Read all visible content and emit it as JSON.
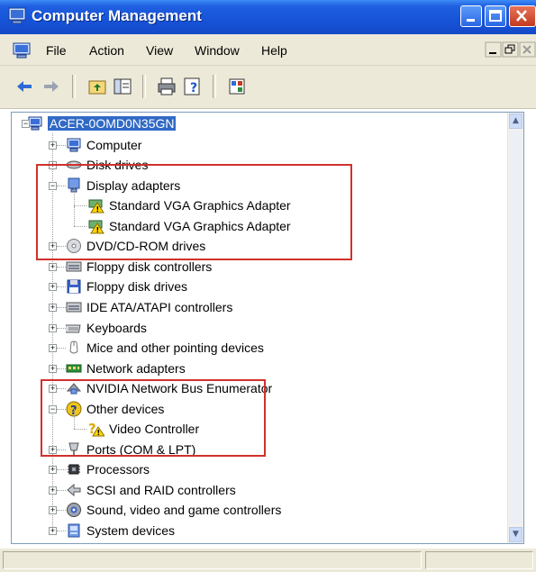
{
  "window": {
    "title": "Computer Management",
    "title_bar_color": "#1653d8"
  },
  "titlebar_buttons": [
    {
      "name": "minimize-icon"
    },
    {
      "name": "maximize-icon"
    },
    {
      "name": "close-icon"
    }
  ],
  "menu": {
    "items": [
      {
        "label": "File"
      },
      {
        "label": "Action"
      },
      {
        "label": "View"
      },
      {
        "label": "Window"
      },
      {
        "label": "Help"
      }
    ]
  },
  "toolbar": {
    "icons": [
      "back-arrow-icon",
      "forward-arrow-icon",
      "up-folder-icon",
      "show-hide-tree-icon",
      "print-icon",
      "help-icon",
      "properties-icon"
    ]
  },
  "tree": {
    "root": {
      "label": "ACER-0OMD0N35GN"
    },
    "items": [
      {
        "label": "Computer",
        "icon": "computer-icon",
        "expanded": false
      },
      {
        "label": "Disk drives",
        "icon": "disk-drive-icon",
        "expanded": false
      },
      {
        "label": "Display adapters",
        "icon": "monitor-icon",
        "expanded": true
      },
      {
        "label": "Standard VGA Graphics Adapter",
        "icon": "warning-adapter-icon",
        "child": true
      },
      {
        "label": "Standard VGA Graphics Adapter",
        "icon": "warning-adapter-icon",
        "child": true
      },
      {
        "label": "DVD/CD-ROM drives",
        "icon": "cdrom-icon",
        "expanded": false
      },
      {
        "label": "Floppy disk controllers",
        "icon": "controller-icon",
        "expanded": false
      },
      {
        "label": "Floppy disk drives",
        "icon": "floppy-icon",
        "expanded": false
      },
      {
        "label": "IDE ATA/ATAPI controllers",
        "icon": "controller-icon",
        "expanded": false
      },
      {
        "label": "Keyboards",
        "icon": "keyboard-icon",
        "expanded": false
      },
      {
        "label": "Mice and other pointing devices",
        "icon": "mouse-icon",
        "expanded": false
      },
      {
        "label": "Network adapters",
        "icon": "network-card-icon",
        "expanded": false
      },
      {
        "label": "NVIDIA Network Bus Enumerator",
        "icon": "network-bus-icon",
        "expanded": false
      },
      {
        "label": "Other devices",
        "icon": "question-icon",
        "expanded": true
      },
      {
        "label": "Video Controller",
        "icon": "question-warning-icon",
        "child": true
      },
      {
        "label": "Ports (COM & LPT)",
        "icon": "port-icon",
        "expanded": false
      },
      {
        "label": "Processors",
        "icon": "processor-icon",
        "expanded": false
      },
      {
        "label": "SCSI and RAID controllers",
        "icon": "scsi-icon",
        "expanded": false
      },
      {
        "label": "Sound, video and game controllers",
        "icon": "speaker-icon",
        "expanded": false
      },
      {
        "label": "System devices",
        "icon": "system-icon",
        "expanded": false
      }
    ]
  },
  "highlight_color": "#d0312d"
}
